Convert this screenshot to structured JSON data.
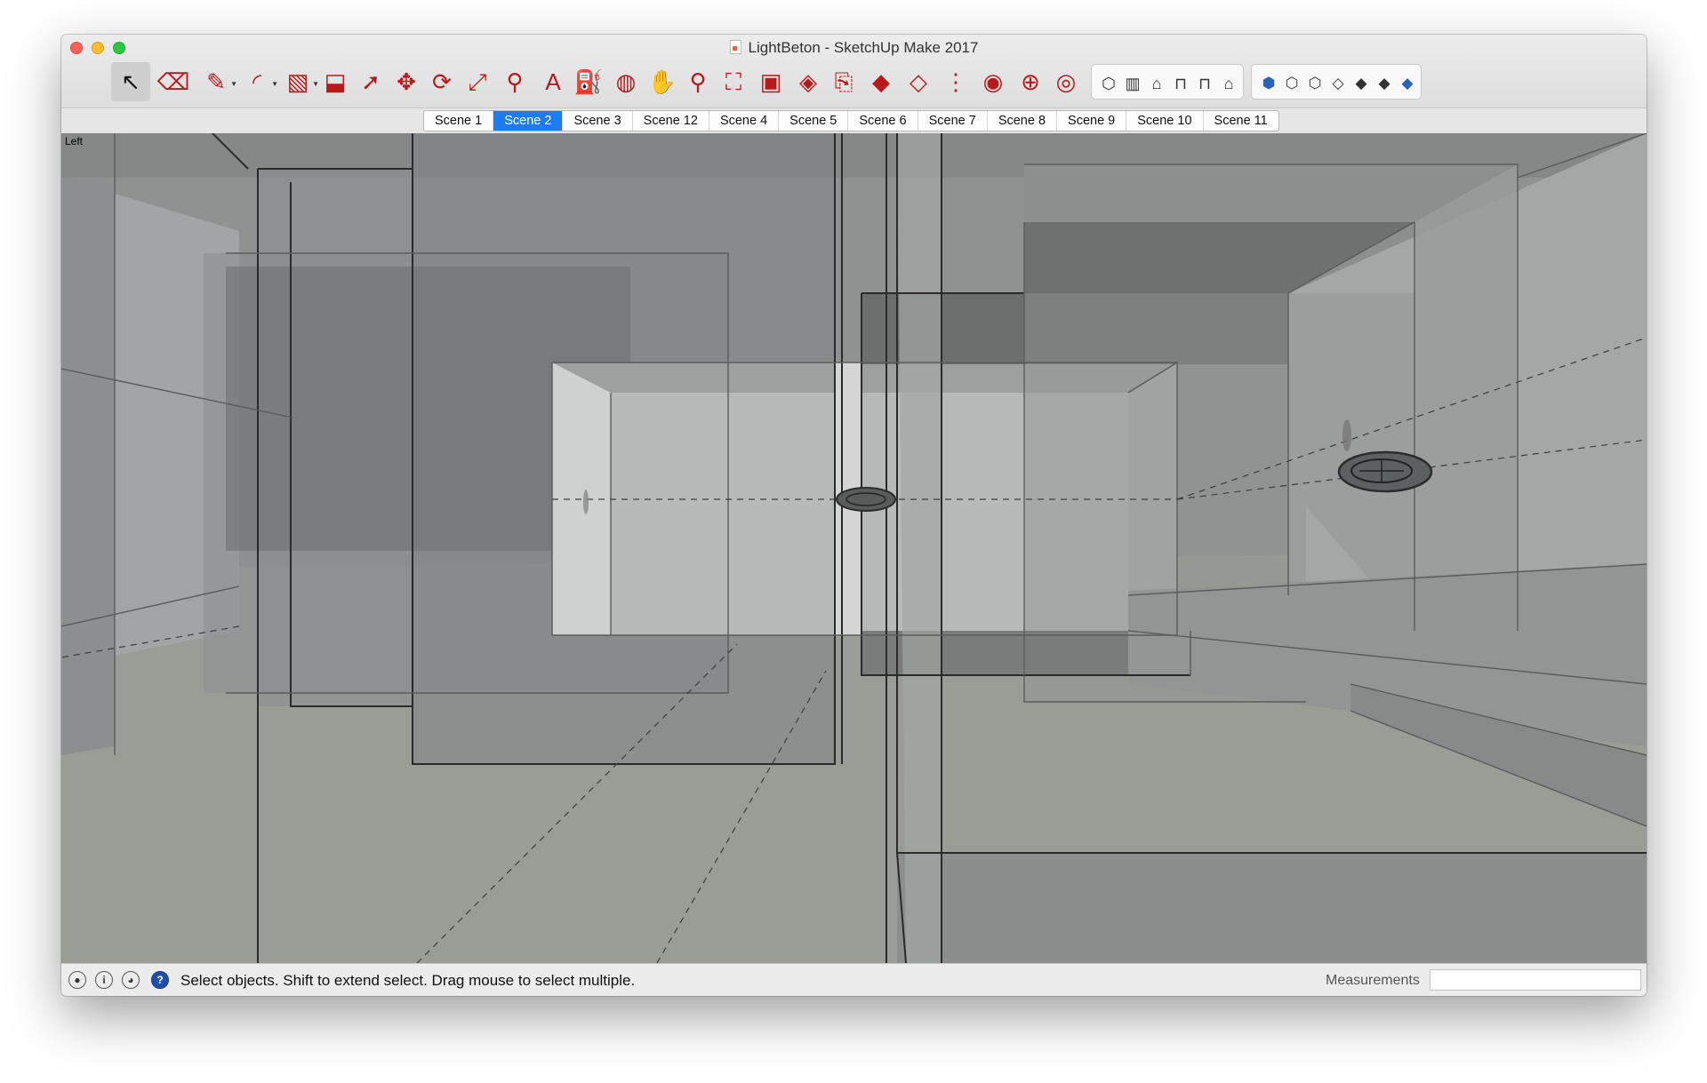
{
  "window": {
    "title": "LightBeton - SketchUp Make 2017"
  },
  "toolbar": {
    "tools": [
      {
        "name": "select-tool",
        "icon": "arrow-icon",
        "glyph": "↖",
        "selected": true
      },
      {
        "name": "eraser-tool",
        "icon": "eraser-icon",
        "glyph": "⌫"
      },
      {
        "name": "line-tool",
        "icon": "pencil-icon",
        "glyph": "✎",
        "dropdown": true
      },
      {
        "name": "arc-tool",
        "icon": "arc-icon",
        "glyph": "◜",
        "dropdown": true
      },
      {
        "name": "rectangle-tool",
        "icon": "rectangle-icon",
        "glyph": "▧",
        "dropdown": true
      },
      {
        "name": "push-pull-tool",
        "icon": "push-pull-icon",
        "glyph": "⬓"
      },
      {
        "name": "follow-me-tool",
        "icon": "follow-me-icon",
        "glyph": "➚"
      },
      {
        "name": "move-tool",
        "icon": "move-icon",
        "glyph": "✥"
      },
      {
        "name": "rotate-tool",
        "icon": "rotate-icon",
        "glyph": "⟳"
      },
      {
        "name": "scale-tool",
        "icon": "scale-icon",
        "glyph": "⤢"
      },
      {
        "name": "tape-measure-tool",
        "icon": "tape-measure-icon",
        "glyph": "⚲"
      },
      {
        "name": "text-tool",
        "icon": "text-icon",
        "glyph": "A"
      },
      {
        "name": "paint-bucket-tool",
        "icon": "paint-bucket-icon",
        "glyph": "⛽"
      },
      {
        "name": "orbit-tool",
        "icon": "orbit-icon",
        "glyph": "◍"
      },
      {
        "name": "pan-tool",
        "icon": "hand-icon",
        "glyph": "✋"
      },
      {
        "name": "zoom-tool",
        "icon": "zoom-icon",
        "glyph": "⚲"
      },
      {
        "name": "zoom-extents-tool",
        "icon": "zoom-extents-icon",
        "glyph": "⛶"
      },
      {
        "name": "warehouse-tool",
        "icon": "warehouse-icon",
        "glyph": "▣"
      },
      {
        "name": "components-tool",
        "icon": "components-icon",
        "glyph": "◈"
      },
      {
        "name": "share-model-tool",
        "icon": "share-model-icon",
        "glyph": "⎘"
      },
      {
        "name": "extension-warehouse-tool",
        "icon": "ruby-icon",
        "glyph": "◆"
      },
      {
        "name": "section-plane-tool",
        "icon": "section-plane-icon",
        "glyph": "◇"
      },
      {
        "name": "walk-tool",
        "icon": "footprints-icon",
        "glyph": "⋮"
      },
      {
        "name": "look-around-tool",
        "icon": "eye-icon",
        "glyph": "◉"
      },
      {
        "name": "position-camera-tool",
        "icon": "position-camera-icon",
        "glyph": "⊕"
      },
      {
        "name": "layout-tool",
        "icon": "layout-icon",
        "glyph": "◎"
      }
    ],
    "views": [
      {
        "name": "iso-view",
        "icon": "iso-view-icon",
        "glyph": "⬡"
      },
      {
        "name": "top-view",
        "icon": "top-view-icon",
        "glyph": "▥"
      },
      {
        "name": "front-view",
        "icon": "front-view-icon",
        "glyph": "⌂"
      },
      {
        "name": "right-view",
        "icon": "right-view-icon",
        "glyph": "⊓"
      },
      {
        "name": "back-view",
        "icon": "back-view-icon",
        "glyph": "⊓"
      },
      {
        "name": "left-view",
        "icon": "left-view-icon",
        "glyph": "⌂"
      }
    ],
    "styles": [
      {
        "name": "xray-style",
        "icon": "xray-icon",
        "glyph": "⬢"
      },
      {
        "name": "wireframe-style",
        "icon": "wireframe-icon",
        "glyph": "⬡"
      },
      {
        "name": "hidden-line-style",
        "icon": "hidden-line-icon",
        "glyph": "⬡"
      },
      {
        "name": "shaded-style",
        "icon": "shaded-icon",
        "glyph": "◇"
      },
      {
        "name": "shaded-textures-style",
        "icon": "shaded-textures-icon",
        "glyph": "◆"
      },
      {
        "name": "monochrome-style",
        "icon": "monochrome-icon",
        "glyph": "◆"
      },
      {
        "name": "back-edges-style",
        "icon": "back-edges-icon",
        "glyph": "◆"
      }
    ]
  },
  "scenes": {
    "tabs": [
      "Scene 1",
      "Scene 2",
      "Scene 3",
      "Scene 12",
      "Scene 4",
      "Scene 5",
      "Scene 6",
      "Scene 7",
      "Scene 8",
      "Scene 9",
      "Scene 10",
      "Scene 11"
    ],
    "active": "Scene 2"
  },
  "viewport": {
    "view_label": "Left"
  },
  "statusbar": {
    "message": "Select objects. Shift to extend select. Drag mouse to select multiple.",
    "measurements_label": "Measurements",
    "measurements_value": ""
  },
  "colors": {
    "accent": "#1e7cf2",
    "viewport_bg": "#8f9290",
    "tool_red": "#b8191b"
  }
}
